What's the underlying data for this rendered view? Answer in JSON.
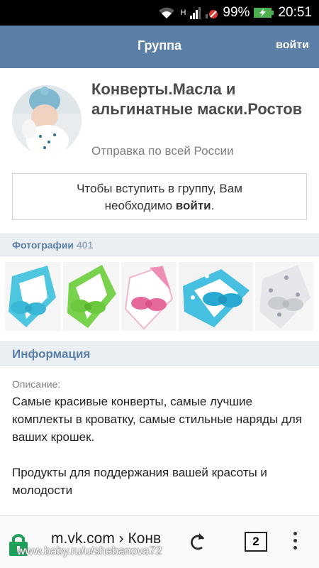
{
  "statusbar": {
    "network": "H",
    "battery": "99%",
    "time": "20:51"
  },
  "topbar": {
    "title": "Группа",
    "login": "войти"
  },
  "group": {
    "name": "Конверты.Масла и альгинатные маски.Ростов",
    "subtitle": "Отправка по всей России",
    "join_text_1": "Чтобы вступить в группу, Вам",
    "join_text_2": "необходимо",
    "join_link": "войти",
    "join_text_3": "."
  },
  "photos": {
    "label": "Фотографии",
    "count": "401",
    "items": [
      {
        "name": "photo-1",
        "color": "#4fc6e0",
        "bow": "#3ab6d6"
      },
      {
        "name": "photo-2",
        "color": "#79d24b",
        "bow": "#6cc83c"
      },
      {
        "name": "photo-3",
        "color": "#f08fb5",
        "bow": "#e56a9b"
      },
      {
        "name": "photo-4",
        "color": "#47bfe0",
        "bow": "#27a9d2"
      },
      {
        "name": "photo-5",
        "color": "#c9ccd1",
        "bow": "#b8bcc2"
      }
    ]
  },
  "info": {
    "label": "Информация",
    "desc_label": "Описание:",
    "desc_text": "Самые красивые конверты, самые лучшие комплекты в кроватку, самые стильные наряды для ваших крошек.\n\nПродукты для поддержания вашей красоты и молодости"
  },
  "browser": {
    "url": "m.vk.com › Конв",
    "tab_count": "2",
    "watermark": "www.baby.ru/u/shebanova72"
  },
  "colors": {
    "topbar": "#5b7fa6",
    "section_bg": "#eaeff4",
    "link": "#5b7fa6"
  }
}
